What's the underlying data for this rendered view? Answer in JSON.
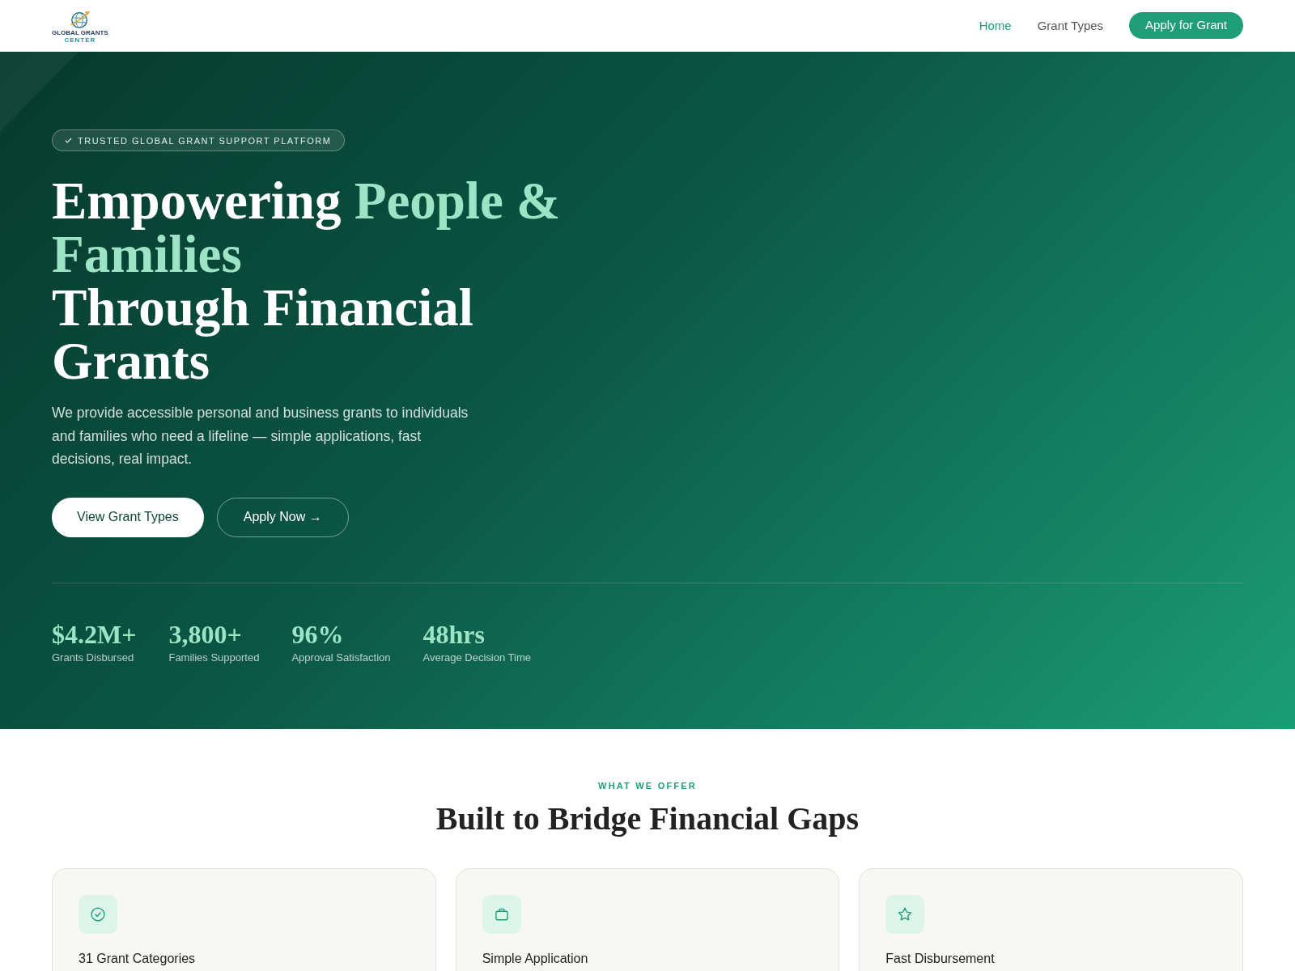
{
  "header": {
    "logo": {
      "lines": [
        "GLOBAL GRANTS",
        "CENTER"
      ]
    },
    "nav": [
      {
        "label": "Home",
        "selected": true
      },
      {
        "label": "Grant Types",
        "selected": false
      }
    ],
    "cta": "Apply for Grant"
  },
  "hero": {
    "badge": "TRUSTED GLOBAL GRANT SUPPORT PLATFORM",
    "heading": [
      [
        {
          "text": "Empowering ",
          "accent": false
        },
        {
          "text": "People & Families",
          "accent": true
        }
      ],
      [
        {
          "text": "Through Financial Grants",
          "accent": false
        }
      ]
    ],
    "intro": "We provide accessible personal and business grants to individuals and families who need a lifeline — simple applications, fast decisions, real impact.",
    "buttons": [
      {
        "label": "View Grant Types",
        "kind": "solid"
      },
      {
        "label": "Apply Now →",
        "kind": "outline"
      }
    ],
    "stats": [
      {
        "value": "$4.2M+",
        "label": "Grants Disbursed"
      },
      {
        "value": "3,800+",
        "label": "Families Supported"
      },
      {
        "value": "96%",
        "label": "Approval Satisfaction"
      },
      {
        "value": "48hrs",
        "label": "Average Decision Time"
      }
    ]
  },
  "offer": {
    "eyebrow": "WHAT WE OFFER",
    "title": "Built to Bridge Financial Gaps",
    "cards": [
      {
        "title": "31 Grant Categories"
      },
      {
        "title": "Simple Application"
      },
      {
        "title": "Fast Disbursement"
      }
    ]
  }
}
